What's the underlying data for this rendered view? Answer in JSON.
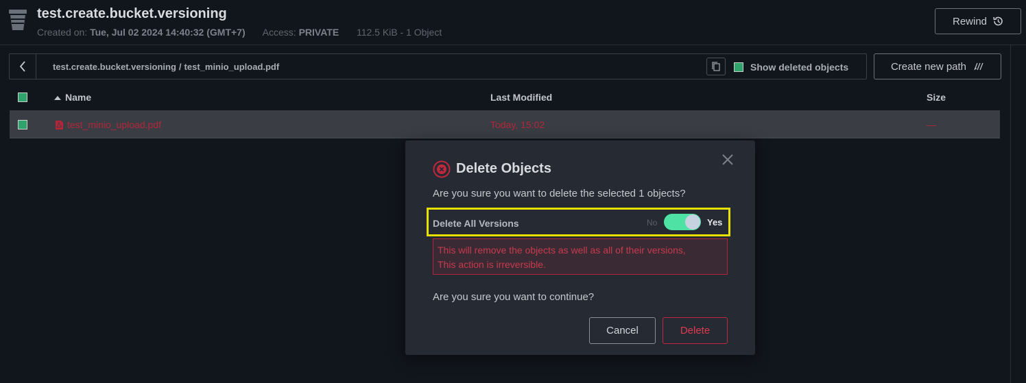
{
  "header": {
    "title": "test.create.bucket.versioning",
    "created_label": "Created on:",
    "created_value": "Tue, Jul 02 2024 14:40:32 (GMT+7)",
    "access_label": "Access:",
    "access_value": "PRIVATE",
    "usage": "112.5 KiB - 1 Object",
    "rewind_label": "Rewind"
  },
  "pathbar": {
    "bucket": "test.create.bucket.versioning",
    "separator": "/",
    "file": "test_minio_upload.pdf",
    "show_deleted_label": "Show deleted objects",
    "create_path_label": "Create new path"
  },
  "table": {
    "columns": {
      "name": "Name",
      "modified": "Last Modified",
      "size": "Size"
    },
    "rows": [
      {
        "name": "test_minio_upload.pdf",
        "modified": "Today, 15:02",
        "size": "—"
      }
    ]
  },
  "modal": {
    "title": "Delete Objects",
    "question": "Are you sure you want to delete the selected 1 objects?",
    "toggle_label": "Delete All Versions",
    "toggle_off": "No",
    "toggle_on": "Yes",
    "warning_line1": "This will remove the objects as well as all of their versions,",
    "warning_line2": "This action is irreversible.",
    "confirm": "Are you sure you want to continue?",
    "cancel_label": "Cancel",
    "delete_label": "Delete"
  },
  "colors": {
    "accent_green": "#4ee3a5",
    "danger": "#c1283e",
    "highlight": "#e8e000"
  },
  "icons": [
    "bucket-icon",
    "history-icon",
    "chevron-left-icon",
    "copy-icon",
    "new-path-icon",
    "sort-up-icon",
    "pdf-icon",
    "close-icon",
    "error-icon"
  ]
}
